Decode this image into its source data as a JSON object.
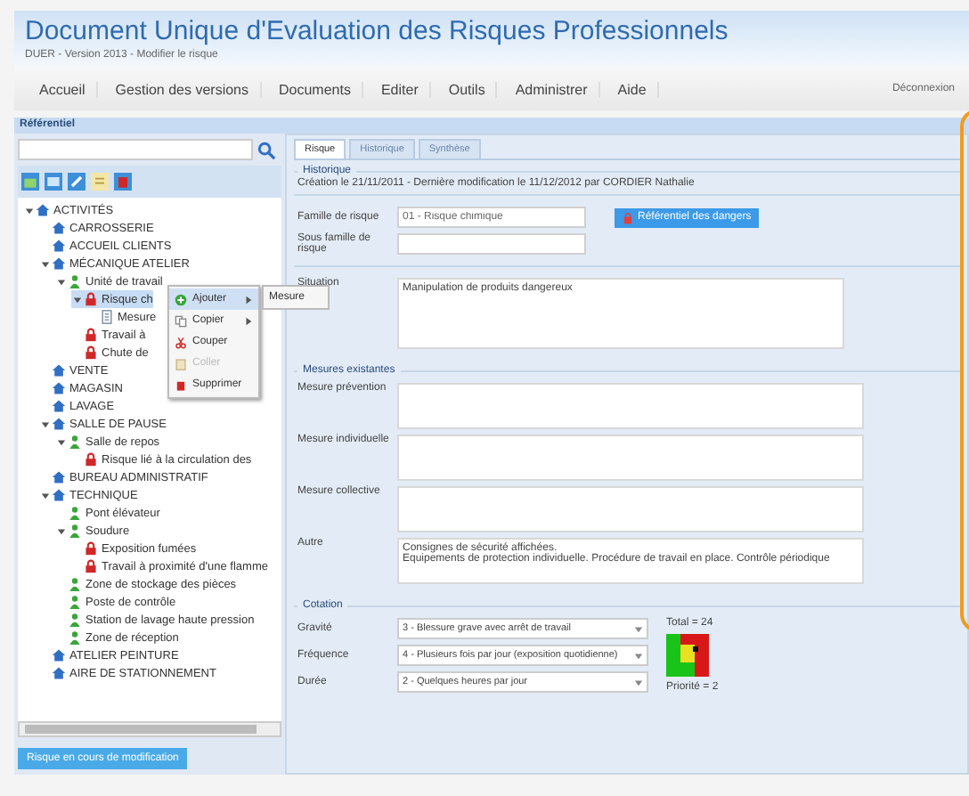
{
  "header": {
    "title": "Document Unique d'Evaluation des Risques Professionnels",
    "subtitle": "DUER - Version 2013 - Modifier le risque"
  },
  "menu": {
    "items": [
      "Accueil",
      "Gestion des versions",
      "Documents",
      "Editer",
      "Outils",
      "Administrer",
      "Aide"
    ],
    "user": "Déconnexion"
  },
  "section_bar": "Référentiel",
  "sidebar": {
    "tree": [
      {
        "label": "ACTIVITÉS",
        "kind": "folder",
        "expanded": true,
        "selected": false,
        "children": [
          {
            "label": "CARROSSERIE",
            "kind": "folder",
            "selected": false
          },
          {
            "label": "ACCUEIL CLIENTS",
            "kind": "folder",
            "selected": false
          },
          {
            "label": "MÉCANIQUE ATELIER",
            "kind": "folder",
            "expanded": true,
            "selected": false,
            "children": [
              {
                "label": "Unité de travail",
                "kind": "unit",
                "expanded": true,
                "selected": false,
                "children": [
                  {
                    "label": "Risque ch",
                    "kind": "risk",
                    "expanded": true,
                    "selected": true,
                    "children": [
                      {
                        "label": "Mesure",
                        "kind": "measure",
                        "selected": false
                      }
                    ]
                  },
                  {
                    "label": "Travail à",
                    "kind": "risk",
                    "selected": false
                  },
                  {
                    "label": "Chute de",
                    "kind": "risk",
                    "selected": false
                  }
                ]
              }
            ]
          },
          {
            "label": "VENTE",
            "kind": "folder",
            "selected": false
          },
          {
            "label": "MAGASIN",
            "kind": "folder",
            "selected": false
          },
          {
            "label": "LAVAGE",
            "kind": "folder",
            "selected": false
          },
          {
            "label": "SALLE DE PAUSE",
            "kind": "folder",
            "expanded": true,
            "selected": false,
            "children": [
              {
                "label": "Salle de repos",
                "kind": "unit",
                "expanded": true,
                "selected": false,
                "children": [
                  {
                    "label": "Risque lié à la circulation des",
                    "kind": "risk",
                    "selected": false
                  }
                ]
              }
            ]
          },
          {
            "label": "BUREAU ADMINISTRATIF",
            "kind": "folder",
            "selected": false
          },
          {
            "label": "TECHNIQUE",
            "kind": "folder",
            "expanded": true,
            "selected": false,
            "children": [
              {
                "label": "Pont élévateur",
                "kind": "unit",
                "selected": false
              },
              {
                "label": "Soudure",
                "kind": "unit",
                "expanded": true,
                "selected": false,
                "children": [
                  {
                    "label": "Exposition fumées",
                    "kind": "risk",
                    "selected": false
                  },
                  {
                    "label": "Travail à proximité d'une flamme",
                    "kind": "risk",
                    "selected": false
                  }
                ]
              },
              {
                "label": "Zone de stockage des pièces",
                "kind": "unit",
                "selected": false
              },
              {
                "label": "Poste de contrôle",
                "kind": "unit",
                "selected": false
              },
              {
                "label": "Station de lavage haute pression",
                "kind": "unit",
                "selected": false
              },
              {
                "label": "Zone de réception",
                "kind": "unit",
                "selected": false
              }
            ]
          },
          {
            "label": "ATELIER PEINTURE",
            "kind": "folder",
            "selected": false
          },
          {
            "label": "AIRE DE STATIONNEMENT",
            "kind": "folder",
            "selected": false
          }
        ]
      }
    ],
    "context_menu": [
      {
        "label": "Ajouter",
        "kind": "add",
        "submenu": true,
        "disabled": false,
        "selected": true
      },
      {
        "label": "Copier",
        "kind": "copy",
        "submenu": true,
        "disabled": false,
        "selected": false
      },
      {
        "label": "Couper",
        "kind": "cut",
        "submenu": false,
        "disabled": false,
        "selected": false
      },
      {
        "label": "Coller",
        "kind": "paste",
        "submenu": false,
        "disabled": true,
        "selected": false
      },
      {
        "label": "Supprimer",
        "kind": "delete",
        "submenu": false,
        "disabled": false,
        "selected": false
      }
    ],
    "submenu": [
      "Mesure"
    ],
    "status_button": "Risque en cours de modification"
  },
  "tabs": [
    {
      "label": "Risque",
      "selected": true
    },
    {
      "label": "Historique",
      "selected": false
    },
    {
      "label": "Synthèse",
      "selected": false
    }
  ],
  "history": {
    "legend": "Historique",
    "text": "Création le 21/11/2011 - Dernière modification le 11/12/2012 par CORDIER Nathalie"
  },
  "risk_fields": [
    {
      "label": "Famille de risque",
      "value": "01 - Risque chimique"
    },
    {
      "label": "Sous famille de risque"
    }
  ],
  "danger_button": "Référentiel des dangers",
  "situation": {
    "label": "Situation",
    "value": "Manipulation de produits dangereux"
  },
  "measures": {
    "legend": "Mesures existantes",
    "fields": [
      {
        "label": "Mesure prévention"
      },
      {
        "label": "Mesure individuelle"
      },
      {
        "label": "Mesure collective"
      },
      {
        "label": "Autre",
        "value": "Consignes de sécurité affichées.\nEquipements de protection individuelle. Procédure de travail en place. Contrôle périodique"
      }
    ]
  },
  "cotation": {
    "legend": "Cotation",
    "fields": [
      {
        "label": "Gravité",
        "value": "3 - Blessure grave avec arrêt de travail"
      },
      {
        "label": "Fréquence",
        "value": "4 - Plusieurs fois par jour (exposition quotidienne)"
      },
      {
        "label": "Durée",
        "value": "2 - Quelques heures par jour"
      }
    ],
    "total": "Total = 24",
    "priority": "Priorité = 2"
  }
}
